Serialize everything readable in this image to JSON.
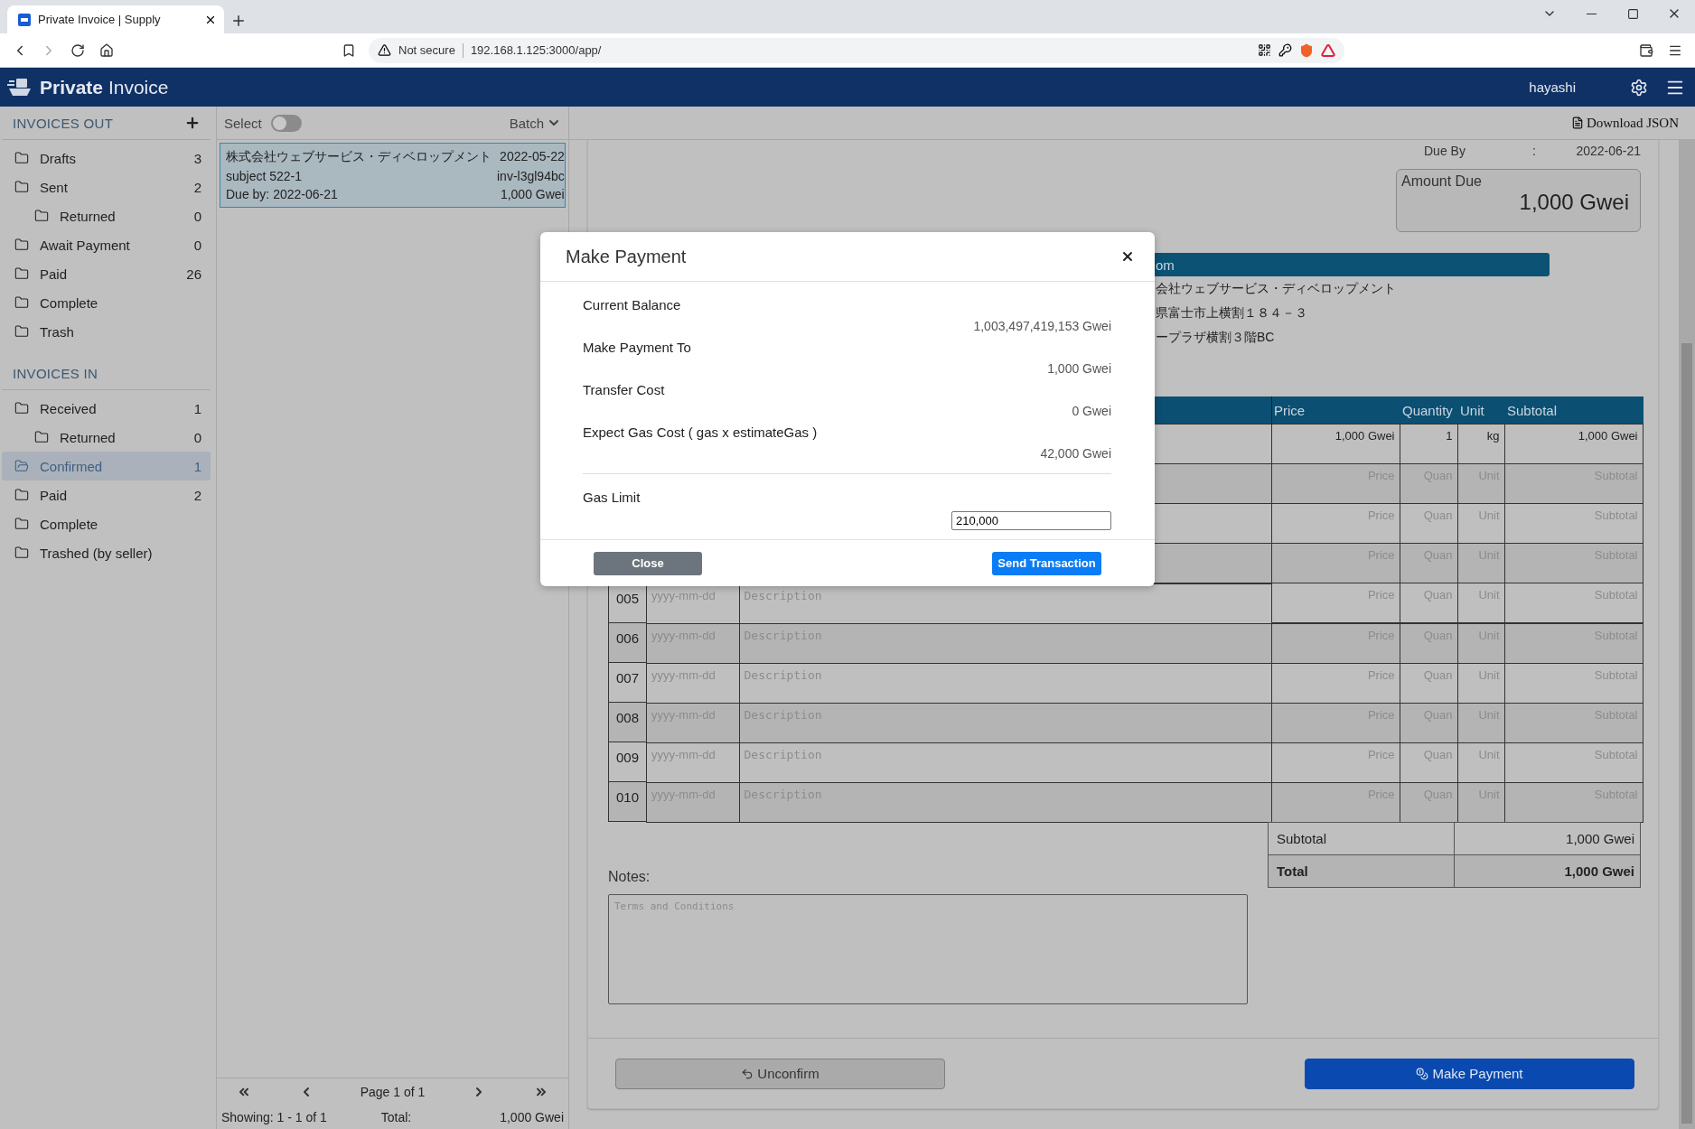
{
  "browser": {
    "tab_title": "Private Invoice | Supply",
    "security": "Not secure",
    "url": "192.168.1.125:3000/app/"
  },
  "app": {
    "brand": "**Private** Invoice",
    "user": "hayashi"
  },
  "sidebar": {
    "sections": [
      {
        "title": "INVOICES OUT",
        "add_button": true,
        "items": [
          {
            "label": "Drafts",
            "count": "3",
            "selected": false
          },
          {
            "label": "Sent",
            "count": "2",
            "selected": false,
            "children": [
              {
                "label": "Returned",
                "count": "0",
                "selected": false
              }
            ]
          },
          {
            "label": "Await Payment",
            "count": "0",
            "selected": false
          },
          {
            "label": "Paid",
            "count": "26",
            "selected": false
          },
          {
            "label": "Complete",
            "selected": false
          },
          {
            "label": "Trash",
            "selected": false
          }
        ]
      },
      {
        "title": "INVOICES IN",
        "add_button": false,
        "items": [
          {
            "label": "Received",
            "count": "1",
            "selected": false,
            "children": [
              {
                "label": "Returned",
                "count": "0",
                "selected": false
              }
            ]
          },
          {
            "label": "Confirmed",
            "count": "1",
            "selected": true
          },
          {
            "label": "Paid",
            "count": "2",
            "selected": false
          },
          {
            "label": "Complete",
            "selected": false
          },
          {
            "label": "Trashed (by seller)",
            "selected": false
          }
        ]
      }
    ]
  },
  "list": {
    "select_label": "Select",
    "select_on": false,
    "batch": "Batch",
    "items": [
      {
        "company": "株式会社ウェブサービス・ディベロップメント",
        "date": "2022-05-22",
        "subject": "subject 522-1",
        "id": "inv-l3gl94bc",
        "due": "Due by: 2022-06-21",
        "amount": "1,000 Gwei",
        "selected": true
      }
    ],
    "pagination": {
      "page": "Page 1 of 1",
      "showing": "Showing: 1 - 1 of 1",
      "total_label": "Total:",
      "total": "1,000 Gwei"
    }
  },
  "toolbar": {
    "download": "Download JSON"
  },
  "invoice": {
    "due_by": {
      "label": "Due By",
      "separator": ":",
      "value": "2022-06-21"
    },
    "amount_due": {
      "label": "Amount Due",
      "value": "1,000 Gwei"
    },
    "from": {
      "title": "om",
      "lines": [
        "会社ウェブサービス・ディベロップメント",
        "県富士市上横割１８４－３",
        "ープラザ横割３階BC"
      ]
    },
    "table": {
      "columns": [
        "Price",
        "Quantity",
        "Unit",
        "Subtotal"
      ],
      "rows": [
        {
          "price": {
            "value": "1,000 Gwei"
          },
          "quantity": {
            "value": "1"
          },
          "unit": {
            "value": "kg"
          },
          "subtotal": {
            "value": "1,000 Gwei"
          }
        },
        {
          "price": {
            "placeholder": "Price"
          },
          "quantity": {
            "placeholder": "Quan"
          },
          "unit": {
            "placeholder": "Unit"
          },
          "subtotal": {
            "placeholder": "Subtotal"
          }
        },
        {
          "price": {
            "placeholder": "Price"
          },
          "quantity": {
            "placeholder": "Quan"
          },
          "unit": {
            "placeholder": "Unit"
          },
          "subtotal": {
            "placeholder": "Subtotal"
          }
        },
        {
          "price": {
            "placeholder": "Price"
          },
          "quantity": {
            "placeholder": "Quan"
          },
          "unit": {
            "placeholder": "Unit"
          },
          "subtotal": {
            "placeholder": "Subtotal"
          }
        },
        {
          "no": "005",
          "date": {
            "placeholder": "yyyy-mm-dd"
          },
          "description": {
            "placeholder": "Description"
          },
          "price": {
            "placeholder": "Price"
          },
          "quantity": {
            "placeholder": "Quan"
          },
          "unit": {
            "placeholder": "Unit"
          },
          "subtotal": {
            "placeholder": "Subtotal"
          }
        },
        {
          "no": "006",
          "date": {
            "placeholder": "yyyy-mm-dd"
          },
          "description": {
            "placeholder": "Description"
          },
          "price": {
            "placeholder": "Price"
          },
          "quantity": {
            "placeholder": "Quan"
          },
          "unit": {
            "placeholder": "Unit"
          },
          "subtotal": {
            "placeholder": "Subtotal"
          }
        },
        {
          "no": "007",
          "date": {
            "placeholder": "yyyy-mm-dd"
          },
          "description": {
            "placeholder": "Description"
          },
          "price": {
            "placeholder": "Price"
          },
          "quantity": {
            "placeholder": "Quan"
          },
          "unit": {
            "placeholder": "Unit"
          },
          "subtotal": {
            "placeholder": "Subtotal"
          }
        },
        {
          "no": "008",
          "date": {
            "placeholder": "yyyy-mm-dd"
          },
          "description": {
            "placeholder": "Description"
          },
          "price": {
            "placeholder": "Price"
          },
          "quantity": {
            "placeholder": "Quan"
          },
          "unit": {
            "placeholder": "Unit"
          },
          "subtotal": {
            "placeholder": "Subtotal"
          }
        },
        {
          "no": "009",
          "date": {
            "placeholder": "yyyy-mm-dd"
          },
          "description": {
            "placeholder": "Description"
          },
          "price": {
            "placeholder": "Price"
          },
          "quantity": {
            "placeholder": "Quan"
          },
          "unit": {
            "placeholder": "Unit"
          },
          "subtotal": {
            "placeholder": "Subtotal"
          }
        },
        {
          "no": "010",
          "date": {
            "placeholder": "yyyy-mm-dd"
          },
          "description": {
            "placeholder": "Description"
          },
          "price": {
            "placeholder": "Price"
          },
          "quantity": {
            "placeholder": "Quan"
          },
          "unit": {
            "placeholder": "Unit"
          },
          "subtotal": {
            "placeholder": "Subtotal"
          }
        }
      ]
    },
    "totals": [
      {
        "label": "Subtotal",
        "value": "1,000 Gwei",
        "kind": "subtotal"
      },
      {
        "label": "Total",
        "value": "1,000 Gwei",
        "kind": "total"
      }
    ],
    "notes": {
      "label": "Notes:",
      "placeholder": "Terms and Conditions"
    },
    "actions": [
      {
        "label": "Unconfirm",
        "kind": "secondary"
      },
      {
        "label": "Make Payment",
        "kind": "primary"
      }
    ]
  },
  "modal": {
    "title": "Make Payment",
    "rows": [
      {
        "label": "Current Balance",
        "value": "1,003,497,419,153 Gwei"
      },
      {
        "label": "Make Payment To",
        "value": "1,000 Gwei"
      },
      {
        "label": "Transfer Cost",
        "value": "0 Gwei"
      },
      {
        "label": "Expect Gas Cost ( gas x estimateGas )",
        "value": "42,000 Gwei"
      }
    ],
    "gas_limit": {
      "label": "Gas Limit",
      "value": "210,000"
    },
    "buttons": [
      {
        "label": "Close",
        "kind": "secondary"
      },
      {
        "label": "Send Transaction",
        "kind": "primary"
      }
    ]
  }
}
